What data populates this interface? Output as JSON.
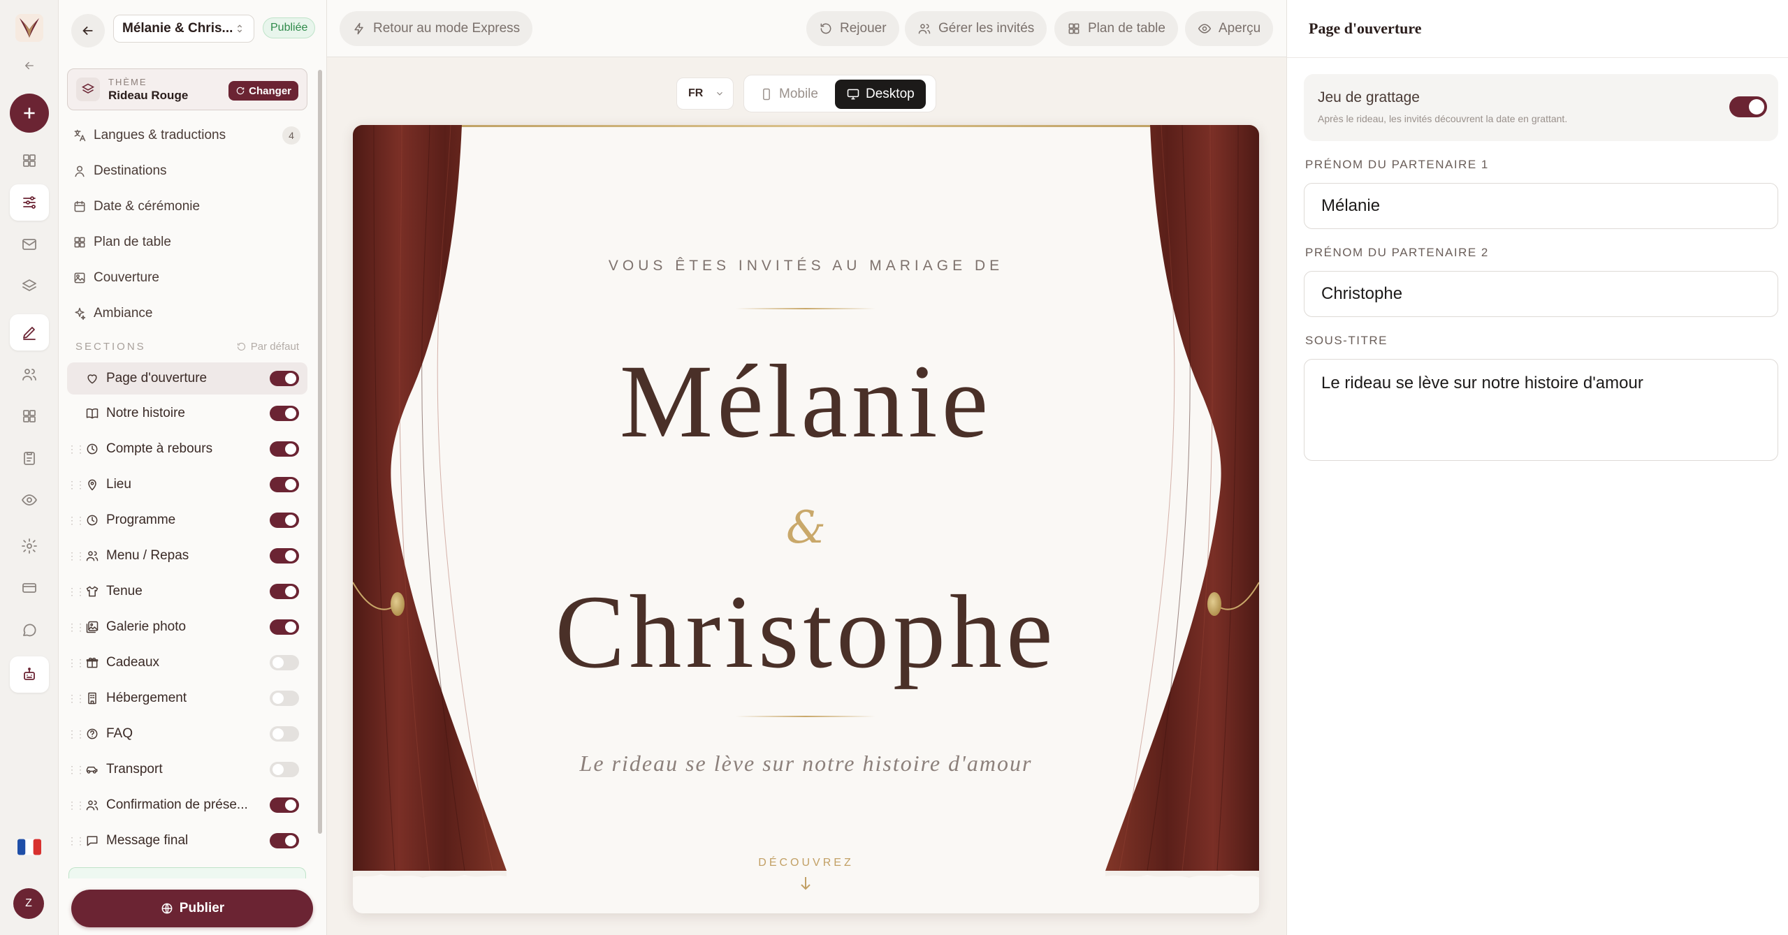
{
  "project": {
    "name": "Mélanie & Chris...",
    "status": "Publiée"
  },
  "theme": {
    "label": "THÈME",
    "name": "Rideau Rouge",
    "change_label": "Changer"
  },
  "nav": [
    {
      "label": "Langues & traductions",
      "icon": "translate-icon",
      "count": "4"
    },
    {
      "label": "Destinations",
      "icon": "person-pin-icon"
    },
    {
      "label": "Date & cérémonie",
      "icon": "calendar-icon"
    },
    {
      "label": "Plan de table",
      "icon": "grid-icon"
    },
    {
      "label": "Couverture",
      "icon": "image-edit-icon"
    },
    {
      "label": "Ambiance",
      "icon": "sparkles-icon"
    }
  ],
  "sections_header": {
    "label": "SECTIONS",
    "reset_label": "Par défaut"
  },
  "sections": [
    {
      "label": "Page d'ouverture",
      "icon": "heart-icon",
      "enabled": true,
      "selected": true
    },
    {
      "label": "Notre histoire",
      "icon": "book-icon",
      "enabled": true
    },
    {
      "label": "Compte à rebours",
      "icon": "clock-icon",
      "enabled": true
    },
    {
      "label": "Lieu",
      "icon": "map-pin-icon",
      "enabled": true
    },
    {
      "label": "Programme",
      "icon": "clock-icon",
      "enabled": true
    },
    {
      "label": "Menu / Repas",
      "icon": "users-icon",
      "enabled": true
    },
    {
      "label": "Tenue",
      "icon": "shirt-icon",
      "enabled": true
    },
    {
      "label": "Galerie photo",
      "icon": "gallery-icon",
      "enabled": true
    },
    {
      "label": "Cadeaux",
      "icon": "gift-icon",
      "enabled": false
    },
    {
      "label": "Hébergement",
      "icon": "building-icon",
      "enabled": false
    },
    {
      "label": "FAQ",
      "icon": "help-circle-icon",
      "enabled": false
    },
    {
      "label": "Transport",
      "icon": "car-icon",
      "enabled": false
    },
    {
      "label": "Confirmation de prése...",
      "icon": "users-icon",
      "enabled": true
    },
    {
      "label": "Message final",
      "icon": "message-icon",
      "enabled": true
    }
  ],
  "publish_label": "Publier",
  "avatar_initial": "Z",
  "topbar": {
    "express_label": "Retour au mode Express",
    "replay_label": "Rejouer",
    "guests_label": "Gérer les invités",
    "table_plan_label": "Plan de table",
    "preview_label": "Aperçu"
  },
  "preview_controls": {
    "lang": "FR",
    "mobile_label": "Mobile",
    "desktop_label": "Desktop"
  },
  "invitation": {
    "intro": "VOUS ÊTES INVITÉS AU MARIAGE DE",
    "partner1": "Mélanie",
    "ampersand": "&",
    "partner2": "Christophe",
    "subtitle": "Le rideau se lève sur notre histoire d'amour",
    "cta": "DÉCOUVREZ"
  },
  "panel": {
    "title": "Page d'ouverture",
    "scratch_title": "Jeu de grattage",
    "scratch_desc": "Après le rideau, les invités découvrent la date en grattant.",
    "scratch_enabled": true,
    "partner1_label": "PRÉNOM DU PARTENAIRE 1",
    "partner1_value": "Mélanie",
    "partner2_label": "PRÉNOM DU PARTENAIRE 2",
    "partner2_value": "Christophe",
    "subtitle_label": "SOUS-TITRE",
    "subtitle_value": "Le rideau se lève sur notre histoire d'amour"
  },
  "colors": {
    "accent": "#6b2433",
    "gold": "#c9a86a",
    "curtain": "#6a2a22"
  }
}
